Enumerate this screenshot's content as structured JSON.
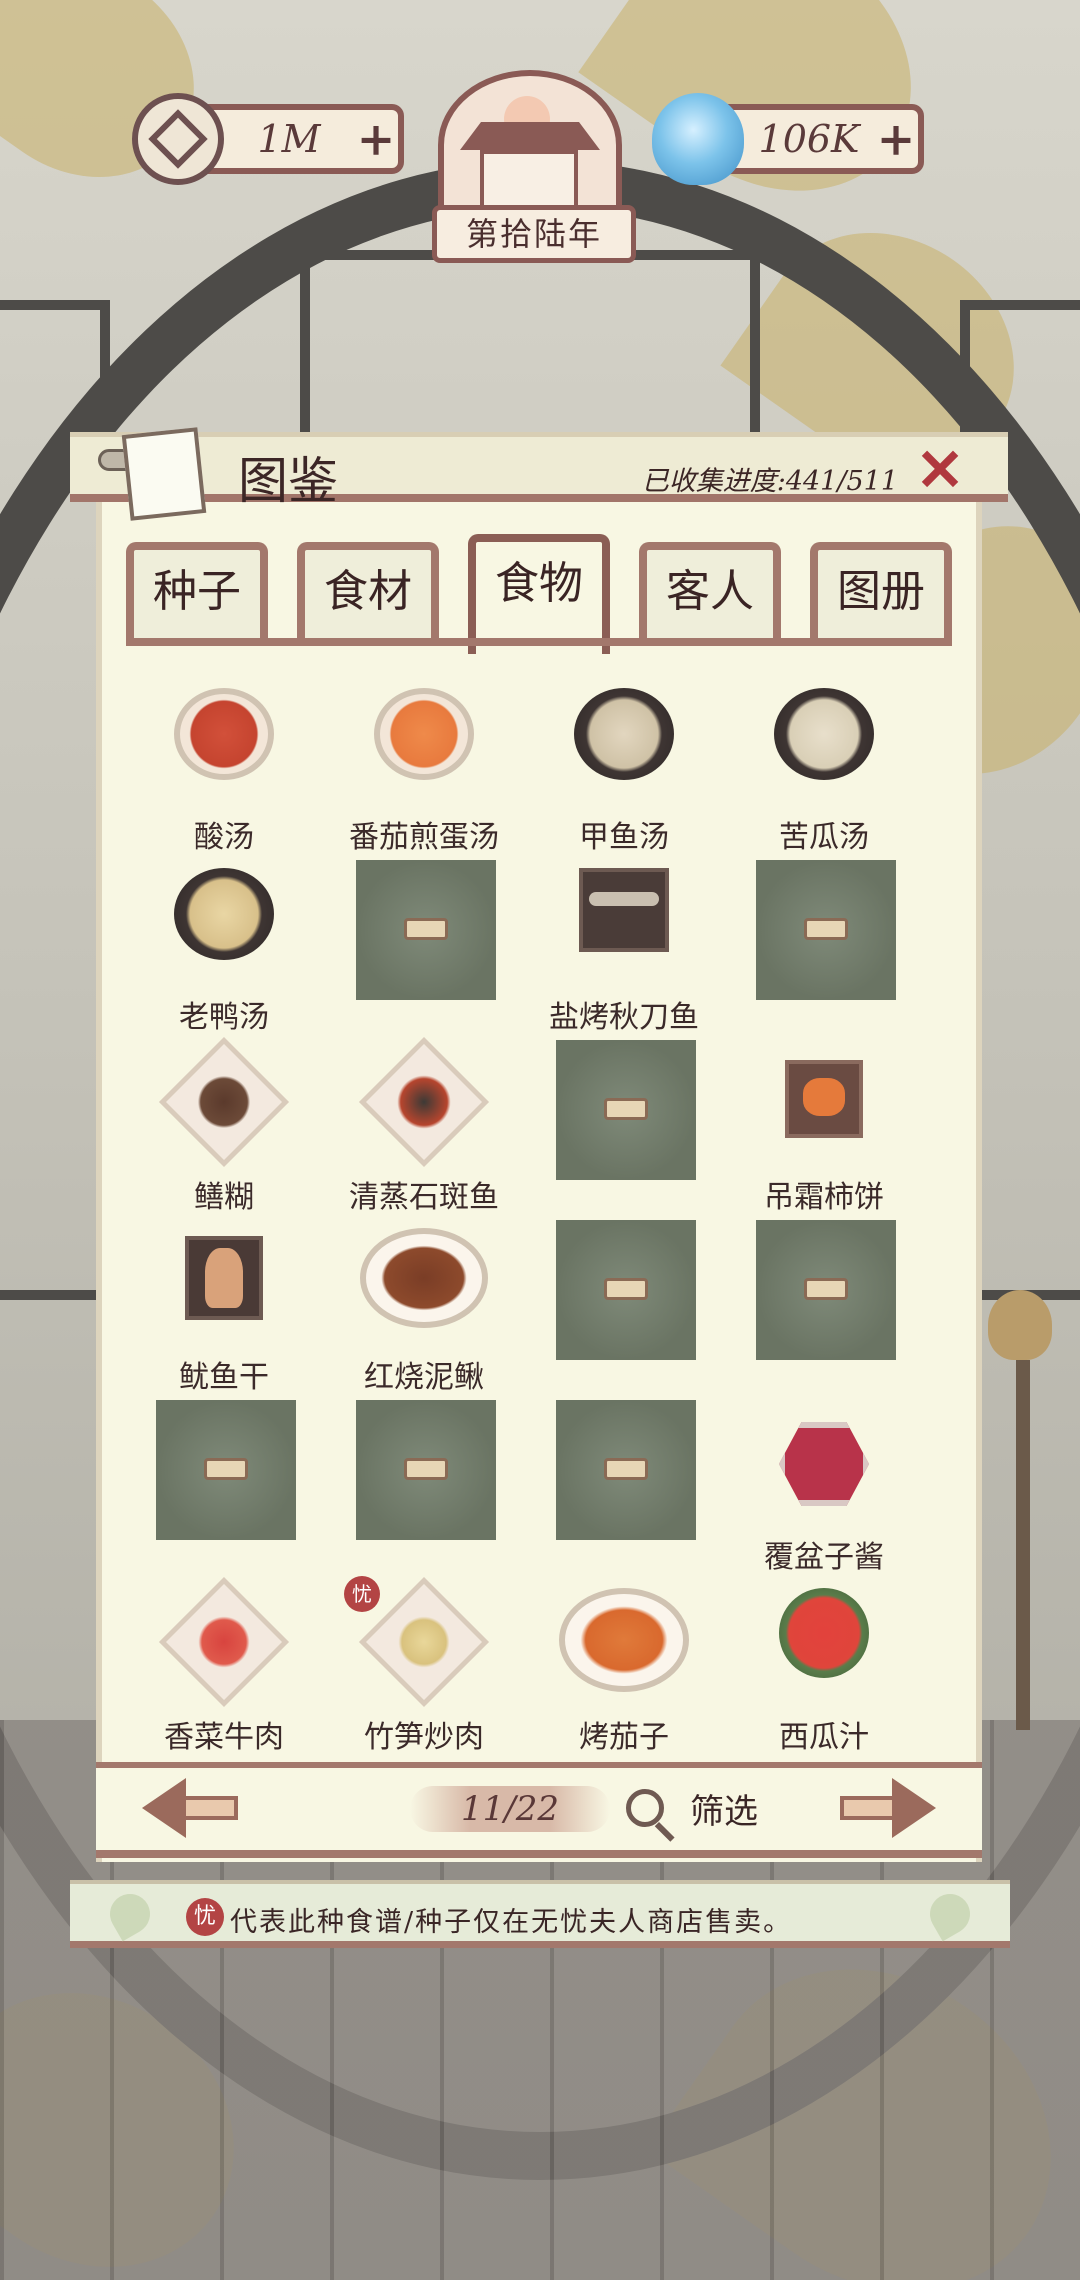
{
  "topbar": {
    "coins": {
      "value": "1M",
      "plus": "+",
      "icon": "coin-icon"
    },
    "jade": {
      "value": "106K",
      "plus": "+",
      "icon": "water-drop-icon"
    },
    "year": "第拾陆年"
  },
  "panel": {
    "title": "图鉴",
    "progress_label": "已收集进度:441/511",
    "close": "✕",
    "tabs": [
      {
        "label": "种子",
        "active": false
      },
      {
        "label": "食材",
        "active": false
      },
      {
        "label": "食物",
        "active": true
      },
      {
        "label": "客人",
        "active": false
      },
      {
        "label": "图册",
        "active": false
      }
    ],
    "items": [
      {
        "name": "酸汤",
        "locked": false,
        "icon": "soup-bowl-red"
      },
      {
        "name": "番茄煎蛋汤",
        "locked": false,
        "icon": "soup-bowl-tomato"
      },
      {
        "name": "甲鱼汤",
        "locked": false,
        "icon": "turtle-soup-pot"
      },
      {
        "name": "苦瓜汤",
        "locked": false,
        "icon": "bitter-melon-soup-pot"
      },
      {
        "name": "老鸭汤",
        "locked": false,
        "icon": "duck-soup-pot"
      },
      {
        "name": "",
        "locked": true,
        "icon": "locked-slot"
      },
      {
        "name": "盐烤秋刀鱼",
        "locked": false,
        "icon": "grilled-saury-plate"
      },
      {
        "name": "",
        "locked": true,
        "icon": "locked-slot"
      },
      {
        "name": "鳝糊",
        "locked": false,
        "icon": "eel-dish"
      },
      {
        "name": "清蒸石斑鱼",
        "locked": false,
        "icon": "steamed-grouper"
      },
      {
        "name": "",
        "locked": true,
        "icon": "locked-slot"
      },
      {
        "name": "吊霜柿饼",
        "locked": false,
        "icon": "persimmon-cake"
      },
      {
        "name": "鱿鱼干",
        "locked": false,
        "icon": "dried-squid"
      },
      {
        "name": "红烧泥鳅",
        "locked": false,
        "icon": "braised-loach"
      },
      {
        "name": "",
        "locked": true,
        "icon": "locked-slot"
      },
      {
        "name": "",
        "locked": true,
        "icon": "locked-slot"
      },
      {
        "name": "",
        "locked": true,
        "icon": "locked-slot"
      },
      {
        "name": "",
        "locked": true,
        "icon": "locked-slot"
      },
      {
        "name": "",
        "locked": true,
        "icon": "locked-slot"
      },
      {
        "name": "覆盆子酱",
        "locked": false,
        "icon": "raspberry-jam"
      },
      {
        "name": "香菜牛肉",
        "locked": false,
        "icon": "coriander-beef"
      },
      {
        "name": "竹笋炒肉",
        "locked": false,
        "icon": "bamboo-shoot-pork",
        "badge": "忧"
      },
      {
        "name": "烤茄子",
        "locked": false,
        "icon": "grilled-eggplant"
      },
      {
        "name": "西瓜汁",
        "locked": false,
        "icon": "watermelon-juice"
      }
    ],
    "pager": {
      "page": "11/22",
      "filter_label": "筛选"
    }
  },
  "note": {
    "badge": "忧",
    "text": "代表此种食谱/种子仅在无忧夫人商店售卖。"
  },
  "colors": {
    "frame": "#a3786c",
    "paper": "#f8f7e3",
    "accent_red": "#b0383e",
    "locked_slot": "#6a7463"
  }
}
